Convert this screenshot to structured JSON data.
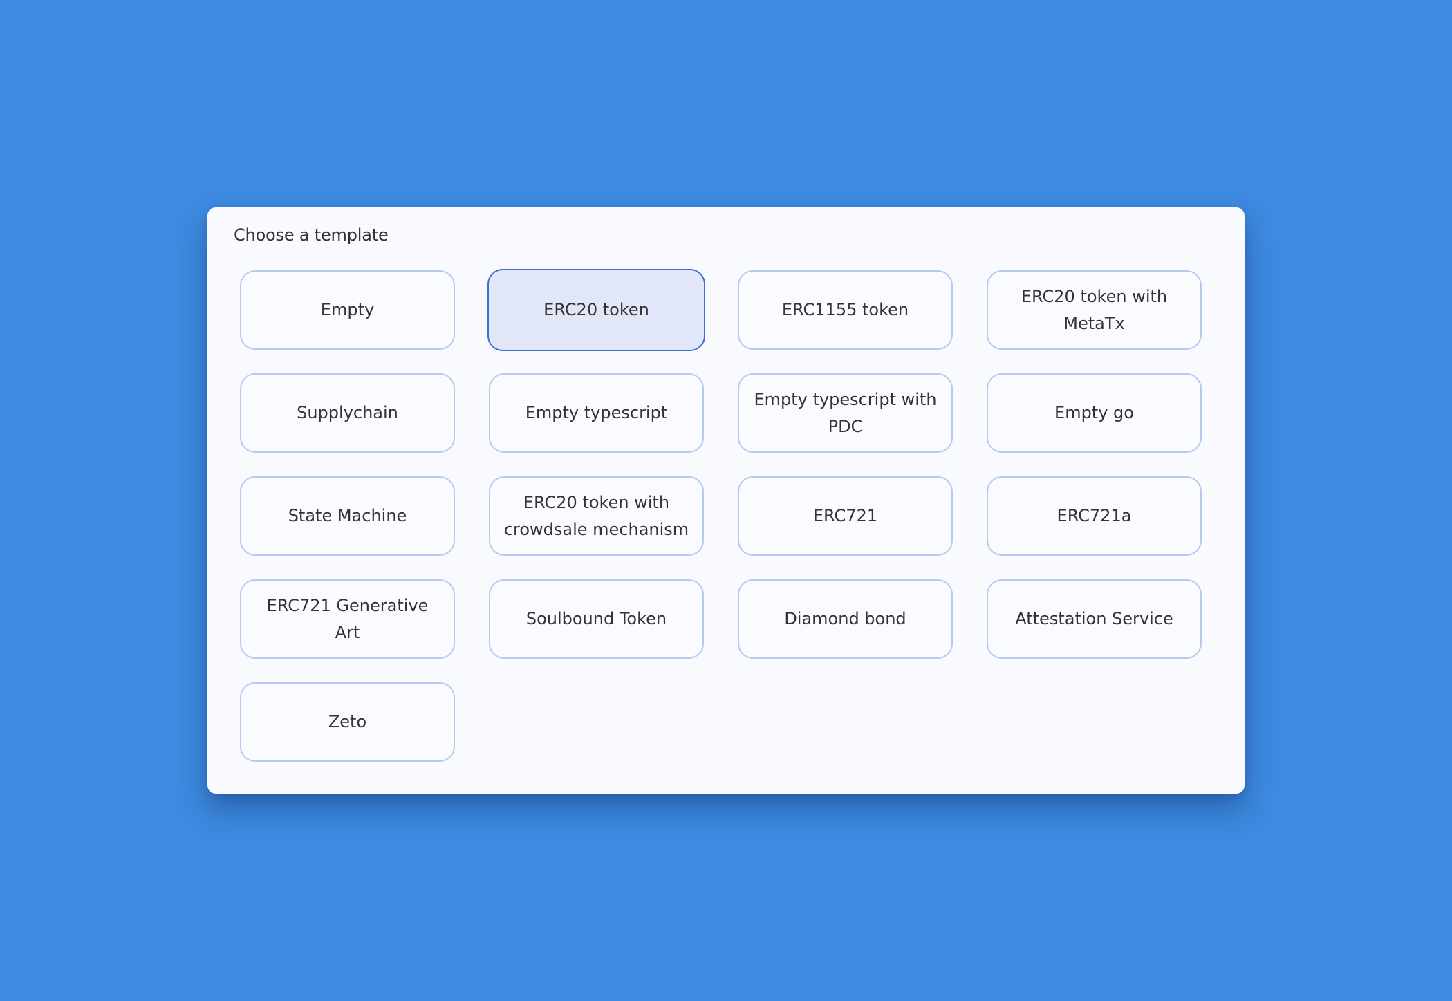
{
  "dialog": {
    "title": "Choose a template",
    "selected_index": 1,
    "templates": [
      {
        "label": "Empty"
      },
      {
        "label": "ERC20 token"
      },
      {
        "label": "ERC1155 token"
      },
      {
        "label": "ERC20 token with MetaTx"
      },
      {
        "label": "Supplychain"
      },
      {
        "label": "Empty typescript"
      },
      {
        "label": "Empty typescript with PDC"
      },
      {
        "label": "Empty go"
      },
      {
        "label": "State Machine"
      },
      {
        "label": "ERC20 token with crowdsale mechanism"
      },
      {
        "label": "ERC721"
      },
      {
        "label": "ERC721a"
      },
      {
        "label": "ERC721 Generative Art"
      },
      {
        "label": "Soulbound Token"
      },
      {
        "label": "Diamond bond"
      },
      {
        "label": "Attestation Service"
      },
      {
        "label": "Zeto"
      }
    ]
  },
  "colors": {
    "background": "#3d8ae0",
    "panel": "#f9fafe",
    "card_border": "#b6c9f1",
    "selected_fill": "#e1e7f8",
    "selected_border": "#3e6fd9",
    "text": "#333333"
  }
}
